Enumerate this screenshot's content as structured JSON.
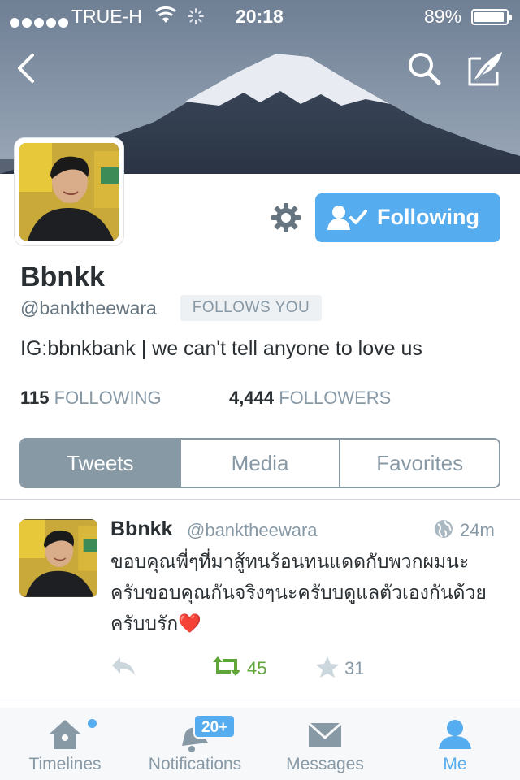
{
  "status_bar": {
    "carrier": "TRUE-H",
    "time": "20:18",
    "battery": "89%"
  },
  "profile": {
    "name": "Bbnkk",
    "handle": "@banktheewara",
    "follows_you_label": "FOLLOWS YOU",
    "bio": "IG:bbnkbank | we can't tell anyone to love us",
    "following_count": "115",
    "following_label": "FOLLOWING",
    "followers_count": "4,444",
    "followers_label": "FOLLOWERS",
    "follow_button_label": "Following"
  },
  "tabs": [
    {
      "label": "Tweets",
      "active": true
    },
    {
      "label": "Media",
      "active": false
    },
    {
      "label": "Favorites",
      "active": false
    }
  ],
  "tweet": {
    "name": "Bbnkk",
    "handle": "@banktheewara",
    "time": "24m",
    "text": "ขอบคุณพี่ๆที่มาสู้ทนร้อนทนแดดกับพวกผมนะครับขอบคุณกันจริงๆนะครับบดูแลตัวเองกันด้วยครับบรัก",
    "emoji": "❤️",
    "retweets": "45",
    "favorites": "31"
  },
  "tab_bar": {
    "items": [
      {
        "label": "Timelines",
        "icon": "home-icon"
      },
      {
        "label": "Notifications",
        "icon": "bell-icon",
        "badge": "20+"
      },
      {
        "label": "Messages",
        "icon": "envelope-icon"
      },
      {
        "label": "Me",
        "icon": "person-icon"
      }
    ]
  },
  "colors": {
    "accent": "#55acee",
    "retweet": "#5fa538",
    "muted": "#8899a6",
    "text": "#292f33"
  }
}
